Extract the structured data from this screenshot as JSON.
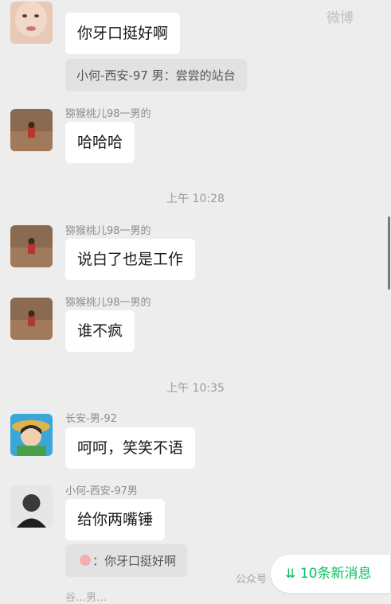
{
  "watermark_top": "微博",
  "watermark_bottom": "公众号 · 猴猴被社畜搞",
  "messages": [
    {
      "text": "你牙口挺好啊",
      "quote": "小何-西安-97 男：尝尝的站台"
    },
    {
      "sender": "猕猴桃儿98一男的",
      "text": "哈哈哈"
    },
    {
      "time": "上午 10:28"
    },
    {
      "sender": "猕猴桃儿98一男的",
      "text": "说白了也是工作"
    },
    {
      "sender": "猕猴桃儿98一男的",
      "text": "谁不疯"
    },
    {
      "time": "上午 10:35"
    },
    {
      "sender": "长安-男-92",
      "text": "呵呵，笑笑不语"
    },
    {
      "sender": "小何-西安-97男",
      "text": "给你两嘴锤",
      "quote": "：你牙口挺好啊"
    }
  ],
  "new_messages_label": "10条新消息",
  "new_messages_icon": "chevron-double-down-icon",
  "partial_bottom_sender": "谷…男…"
}
